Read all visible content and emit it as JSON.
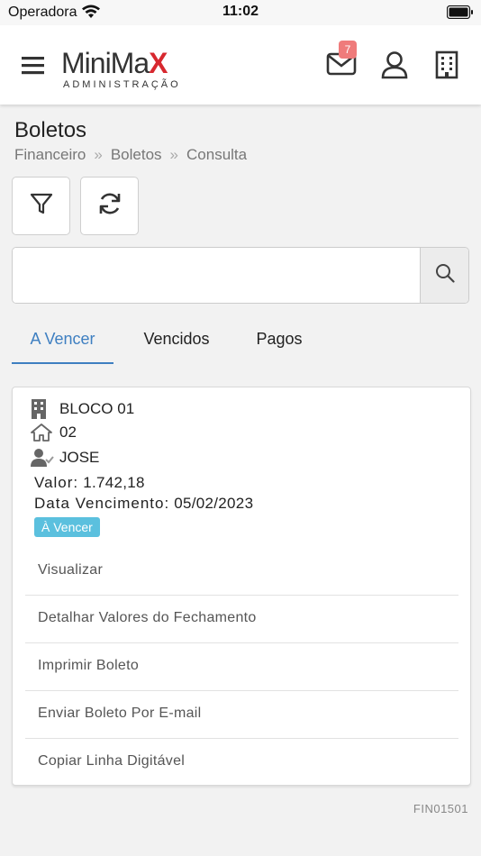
{
  "status_bar": {
    "carrier": "Operadora",
    "time": "11:02"
  },
  "header": {
    "logo_main_left": "MiniMa",
    "logo_main_x": "X",
    "logo_sub": "ADMINISTRAÇÃO",
    "mail_badge_count": "7",
    "icons": [
      "menu-icon",
      "mail-icon",
      "user-icon",
      "building-icon"
    ]
  },
  "page": {
    "title": "Boletos",
    "breadcrumb": [
      "Financeiro",
      "Boletos",
      "Consulta"
    ]
  },
  "toolbar": {
    "icons": [
      "filter-icon",
      "refresh-icon"
    ]
  },
  "search": {
    "value": "",
    "placeholder": "",
    "icon": "search-icon"
  },
  "tabs": [
    {
      "label": "A Vencer",
      "active": true
    },
    {
      "label": "Vencidos",
      "active": false
    },
    {
      "label": "Pagos",
      "active": false
    }
  ],
  "card": {
    "bloco": "BLOCO 01",
    "unidade": "02",
    "pessoa": "JOSE",
    "valor_label": "Valor:",
    "valor": "1.742,18",
    "vencimento_label": "Data Vencimento:",
    "vencimento": "05/02/2023",
    "status": "À Vencer",
    "status_color": "#5bc0de",
    "actions": [
      "Visualizar",
      "Detalhar Valores do Fechamento",
      "Imprimir Boleto",
      "Enviar Boleto Por E-mail",
      "Copiar Linha Digitável"
    ]
  },
  "footer": {
    "code": "FIN01501"
  },
  "colors": {
    "accent": "#3e7fc1",
    "badge": "#ef7b7b",
    "brand_red": "#d7282f"
  }
}
